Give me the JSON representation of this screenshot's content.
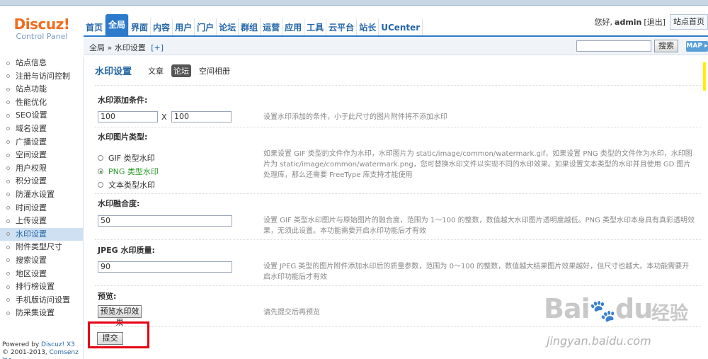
{
  "logo": {
    "main": "Discuz!",
    "sub": "Control Panel"
  },
  "nav": [
    {
      "label": "首页",
      "active": false
    },
    {
      "label": "全局",
      "active": true
    },
    {
      "label": "界面",
      "active": false
    },
    {
      "label": "内容",
      "active": false
    },
    {
      "label": "用户",
      "active": false
    },
    {
      "label": "门户",
      "active": false
    },
    {
      "label": "论坛",
      "active": false
    },
    {
      "label": "群组",
      "active": false
    },
    {
      "label": "运营",
      "active": false
    },
    {
      "label": "应用",
      "active": false
    },
    {
      "label": "工具",
      "active": false
    },
    {
      "label": "云平台",
      "active": false
    },
    {
      "label": "站长",
      "active": false
    },
    {
      "label": "UCenter",
      "active": false
    }
  ],
  "userbar": {
    "greeting": "您好,",
    "username": "admin",
    "logout": "[退出]",
    "site_home": "站点首页"
  },
  "breadcrumb": {
    "text": "全局 » 水印设置",
    "add": "[+]"
  },
  "search": {
    "button": "搜索",
    "map": "MAP"
  },
  "sidebar": {
    "items": [
      {
        "label": "站点信息",
        "active": false
      },
      {
        "label": "注册与访问控制",
        "active": false
      },
      {
        "label": "站点功能",
        "active": false
      },
      {
        "label": "性能优化",
        "active": false
      },
      {
        "label": "SEO设置",
        "active": false
      },
      {
        "label": "域名设置",
        "active": false
      },
      {
        "label": "广播设置",
        "active": false
      },
      {
        "label": "空间设置",
        "active": false
      },
      {
        "label": "用户权限",
        "active": false
      },
      {
        "label": "积分设置",
        "active": false
      },
      {
        "label": "防灌水设置",
        "active": false
      },
      {
        "label": "时间设置",
        "active": false
      },
      {
        "label": "上传设置",
        "active": false
      },
      {
        "label": "水印设置",
        "active": true
      },
      {
        "label": "附件类型尺寸",
        "active": false
      },
      {
        "label": "搜索设置",
        "active": false
      },
      {
        "label": "地区设置",
        "active": false
      },
      {
        "label": "排行榜设置",
        "active": false
      },
      {
        "label": "手机版访问设置",
        "active": false
      },
      {
        "label": "防采集设置",
        "active": false
      }
    ],
    "footer": {
      "powered": "Powered by ",
      "powered_link": "Discuz! X3",
      "copy": "© 2001-2013, ",
      "copy_link": "Comsenz Inc."
    }
  },
  "subtabs": {
    "title": "水印设置",
    "tabs": [
      "文章",
      "论坛",
      "空间相册"
    ],
    "active_index": 1
  },
  "form": {
    "condition": {
      "label": "水印添加条件:",
      "width": "100",
      "times": "X",
      "height": "100",
      "tip": "设置水印添加的条件，小于此尺寸的图片附件将不添加水印"
    },
    "type": {
      "label": "水印图片类型:",
      "options": [
        "GIF 类型水印",
        "PNG 类型水印",
        "文本类型水印"
      ],
      "selected_index": 1,
      "tip": "如果设置 GIF 类型的文件作为水印，水印图片为 static/image/common/watermark.gif，如果设置 PNG 类型的文件作为水印，水印图片为 static/image/common/watermark.png，您可替换水印文件以实现不同的水印效果。如果设置文本类型的水印并且使用 GD 图片处理库，那么还需要 FreeType 库支持才能使用"
    },
    "blend": {
      "label": "水印融合度:",
      "value": "50",
      "tip": "设置 GIF 类型水印图片与原始图片的融合度，范围为 1～100 的整数，数值越大水印图片透明度越低。PNG 类型水印本身具有真彩透明效果，无须此设置。本功能需要开启水印功能后才有效"
    },
    "quality": {
      "label": "JPEG 水印质量:",
      "value": "90",
      "tip": "设置 JPEG 类型的图片附件添加水印后的质量参数，范围为 0～100 的整数，数值越大结果图片效果越好，但尺寸也越大。本功能需要开启水印功能后才有效"
    },
    "preview": {
      "label": "预览:",
      "button": "预览水印效果",
      "tip": "请先提交后再预览"
    },
    "submit": "提交"
  },
  "watermark": {
    "brand": "Bai",
    "brand2": "du",
    "cn": "经验",
    "url": "jingyan.baidu.com"
  },
  "colors": {
    "accent": "#2b7acb",
    "logo": "#f26c1d",
    "highlight": "#e60012",
    "selected": "#2b9a2b"
  }
}
